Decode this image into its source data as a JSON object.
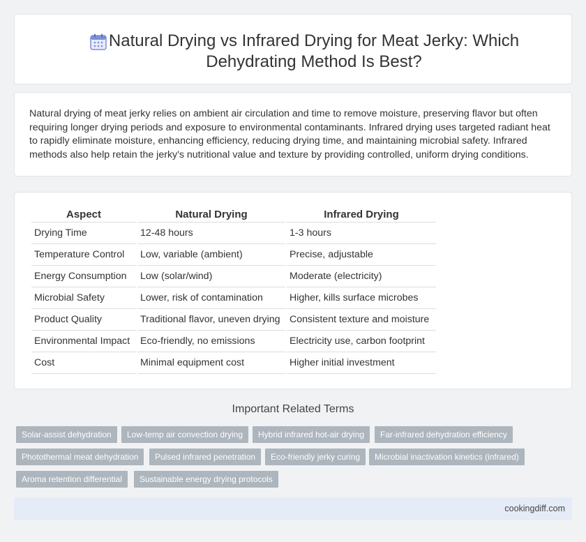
{
  "header": {
    "title": "Natural Drying vs Infrared Drying for Meat Jerky: Which Dehydrating Method Is Best?",
    "icon": "calendar-icon"
  },
  "intro": {
    "text": "Natural drying of meat jerky relies on ambient air circulation and time to remove moisture, preserving flavor but often requiring longer drying periods and exposure to environmental contaminants. Infrared drying uses targeted radiant heat to rapidly eliminate moisture, enhancing efficiency, reducing drying time, and maintaining microbial safety. Infrared methods also help retain the jerky's nutritional value and texture by providing controlled, uniform drying conditions."
  },
  "table": {
    "headers": [
      "Aspect",
      "Natural Drying",
      "Infrared Drying"
    ],
    "rows": [
      [
        "Drying Time",
        "12-48 hours",
        "1-3 hours"
      ],
      [
        "Temperature Control",
        "Low, variable (ambient)",
        "Precise, adjustable"
      ],
      [
        "Energy Consumption",
        "Low (solar/wind)",
        "Moderate (electricity)"
      ],
      [
        "Microbial Safety",
        "Lower, risk of contamination",
        "Higher, kills surface microbes"
      ],
      [
        "Product Quality",
        "Traditional flavor, uneven drying",
        "Consistent texture and moisture"
      ],
      [
        "Environmental Impact",
        "Eco-friendly, no emissions",
        "Electricity use, carbon footprint"
      ],
      [
        "Cost",
        "Minimal equipment cost",
        "Higher initial investment"
      ]
    ]
  },
  "related": {
    "title": "Important Related Terms",
    "tags": [
      "Solar-assist dehydration",
      "Low-temp air convection drying",
      "Hybrid infrared hot-air drying",
      "Far-infrared dehydration efficiency",
      "Photothermal meat dehydration",
      "Pulsed infrared penetration",
      "Eco-friendly jerky curing",
      "Microbial inactivation kinetics (infrared)",
      "Aroma retention differential",
      "Sustainable energy drying protocols"
    ]
  },
  "footer": {
    "site": "cookingdiff.com"
  },
  "colors": {
    "background": "#f1f2f4",
    "tag_background": "#adb5bd",
    "footer_background": "#e6ecf7",
    "icon_accent": "#7b8fd9"
  }
}
